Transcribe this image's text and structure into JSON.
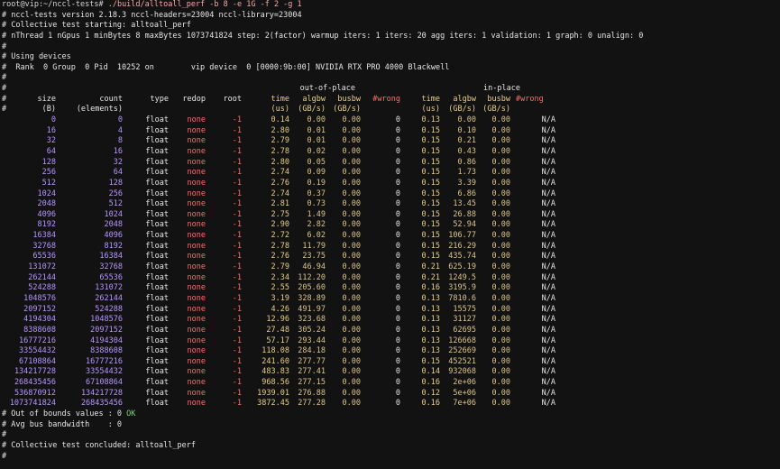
{
  "terminal": {
    "prompt": "root@vip:~/nccl-tests#",
    "command": " ./build/alltoall_perf -b 8 -e 1G -f 2 -g 1",
    "lines": [
      "# nccl-tests version 2.18.3 nccl-headers=23004 nccl-library=23004",
      "# Collective test starting: alltoall_perf",
      "# nThread 1 nGpus 1 minBytes 8 maxBytes 1073741824 step: 2(factor) warmup iters: 1 iters: 20 agg iters: 1 validation: 1 graph: 0 unalign: 0",
      "#",
      "# Using devices",
      "#  Rank  0 Group  0 Pid  10252 on        vip device  0 [0000:9b:00] NVIDIA RTX PRO 4000 Blackwell",
      "#"
    ],
    "table_header": {
      "group_out": "out-of-place",
      "group_in": "in-place",
      "row1": [
        "#",
        "size",
        "count",
        "type",
        "redop",
        "root",
        "time",
        "algbw",
        "busbw",
        "#wrong",
        "time",
        "algbw",
        "busbw",
        "#wrong"
      ],
      "row2": [
        "#",
        "(B)",
        "(elements)",
        "",
        "",
        "",
        "(us)",
        "(GB/s)",
        "(GB/s)",
        "",
        "(us)",
        "(GB/s)",
        "(GB/s)",
        ""
      ]
    },
    "rows": [
      [
        "0",
        "0",
        "float",
        "none",
        "-1",
        "0.14",
        "0.00",
        "0.00",
        "0",
        "0.13",
        "0.00",
        "0.00",
        "N/A"
      ],
      [
        "16",
        "4",
        "float",
        "none",
        "-1",
        "2.80",
        "0.01",
        "0.00",
        "0",
        "0.15",
        "0.10",
        "0.00",
        "N/A"
      ],
      [
        "32",
        "8",
        "float",
        "none",
        "-1",
        "2.79",
        "0.01",
        "0.00",
        "0",
        "0.15",
        "0.21",
        "0.00",
        "N/A"
      ],
      [
        "64",
        "16",
        "float",
        "none",
        "-1",
        "2.78",
        "0.02",
        "0.00",
        "0",
        "0.15",
        "0.43",
        "0.00",
        "N/A"
      ],
      [
        "128",
        "32",
        "float",
        "none",
        "-1",
        "2.80",
        "0.05",
        "0.00",
        "0",
        "0.15",
        "0.86",
        "0.00",
        "N/A"
      ],
      [
        "256",
        "64",
        "float",
        "none",
        "-1",
        "2.74",
        "0.09",
        "0.00",
        "0",
        "0.15",
        "1.73",
        "0.00",
        "N/A"
      ],
      [
        "512",
        "128",
        "float",
        "none",
        "-1",
        "2.76",
        "0.19",
        "0.00",
        "0",
        "0.15",
        "3.39",
        "0.00",
        "N/A"
      ],
      [
        "1024",
        "256",
        "float",
        "none",
        "-1",
        "2.74",
        "0.37",
        "0.00",
        "0",
        "0.15",
        "6.86",
        "0.00",
        "N/A"
      ],
      [
        "2048",
        "512",
        "float",
        "none",
        "-1",
        "2.81",
        "0.73",
        "0.00",
        "0",
        "0.15",
        "13.45",
        "0.00",
        "N/A"
      ],
      [
        "4096",
        "1024",
        "float",
        "none",
        "-1",
        "2.75",
        "1.49",
        "0.00",
        "0",
        "0.15",
        "26.88",
        "0.00",
        "N/A"
      ],
      [
        "8192",
        "2048",
        "float",
        "none",
        "-1",
        "2.90",
        "2.82",
        "0.00",
        "0",
        "0.15",
        "52.94",
        "0.00",
        "N/A"
      ],
      [
        "16384",
        "4096",
        "float",
        "none",
        "-1",
        "2.72",
        "6.02",
        "0.00",
        "0",
        "0.15",
        "106.77",
        "0.00",
        "N/A"
      ],
      [
        "32768",
        "8192",
        "float",
        "none",
        "-1",
        "2.78",
        "11.79",
        "0.00",
        "0",
        "0.15",
        "216.29",
        "0.00",
        "N/A"
      ],
      [
        "65536",
        "16384",
        "float",
        "none",
        "-1",
        "2.76",
        "23.75",
        "0.00",
        "0",
        "0.15",
        "435.74",
        "0.00",
        "N/A"
      ],
      [
        "131072",
        "32768",
        "float",
        "none",
        "-1",
        "2.79",
        "46.94",
        "0.00",
        "0",
        "0.21",
        "625.19",
        "0.00",
        "N/A"
      ],
      [
        "262144",
        "65536",
        "float",
        "none",
        "-1",
        "2.34",
        "112.20",
        "0.00",
        "0",
        "0.21",
        "1249.5",
        "0.00",
        "N/A"
      ],
      [
        "524288",
        "131072",
        "float",
        "none",
        "-1",
        "2.55",
        "205.60",
        "0.00",
        "0",
        "0.16",
        "3195.9",
        "0.00",
        "N/A"
      ],
      [
        "1048576",
        "262144",
        "float",
        "none",
        "-1",
        "3.19",
        "328.89",
        "0.00",
        "0",
        "0.13",
        "7810.6",
        "0.00",
        "N/A"
      ],
      [
        "2097152",
        "524288",
        "float",
        "none",
        "-1",
        "4.26",
        "491.97",
        "0.00",
        "0",
        "0.13",
        "15575",
        "0.00",
        "N/A"
      ],
      [
        "4194304",
        "1048576",
        "float",
        "none",
        "-1",
        "12.96",
        "323.68",
        "0.00",
        "0",
        "0.13",
        "31127",
        "0.00",
        "N/A"
      ],
      [
        "8388608",
        "2097152",
        "float",
        "none",
        "-1",
        "27.48",
        "305.24",
        "0.00",
        "0",
        "0.13",
        "62695",
        "0.00",
        "N/A"
      ],
      [
        "16777216",
        "4194304",
        "float",
        "none",
        "-1",
        "57.17",
        "293.44",
        "0.00",
        "0",
        "0.13",
        "126668",
        "0.00",
        "N/A"
      ],
      [
        "33554432",
        "8388608",
        "float",
        "none",
        "-1",
        "118.08",
        "284.18",
        "0.00",
        "0",
        "0.13",
        "252669",
        "0.00",
        "N/A"
      ],
      [
        "67108864",
        "16777216",
        "float",
        "none",
        "-1",
        "241.60",
        "277.77",
        "0.00",
        "0",
        "0.15",
        "452521",
        "0.00",
        "N/A"
      ],
      [
        "134217728",
        "33554432",
        "float",
        "none",
        "-1",
        "483.83",
        "277.41",
        "0.00",
        "0",
        "0.14",
        "932068",
        "0.00",
        "N/A"
      ],
      [
        "268435456",
        "67108864",
        "float",
        "none",
        "-1",
        "968.56",
        "277.15",
        "0.00",
        "0",
        "0.16",
        "2e+06",
        "0.00",
        "N/A"
      ],
      [
        "536870912",
        "134217728",
        "float",
        "none",
        "-1",
        "1939.01",
        "276.88",
        "0.00",
        "0",
        "0.12",
        "5e+06",
        "0.00",
        "N/A"
      ],
      [
        "1073741824",
        "268435456",
        "float",
        "none",
        "-1",
        "3872.45",
        "277.28",
        "0.00",
        "0",
        "0.16",
        "7e+06",
        "0.00",
        "N/A"
      ]
    ],
    "footer": {
      "oob_label": "# Out of bounds values : 0 ",
      "oob_status": "OK",
      "avg_bus": "# Avg bus bandwidth    : 0",
      "blank1": "#",
      "concluded": "# Collective test concluded: alltoall_perf",
      "blank2": "#"
    }
  }
}
